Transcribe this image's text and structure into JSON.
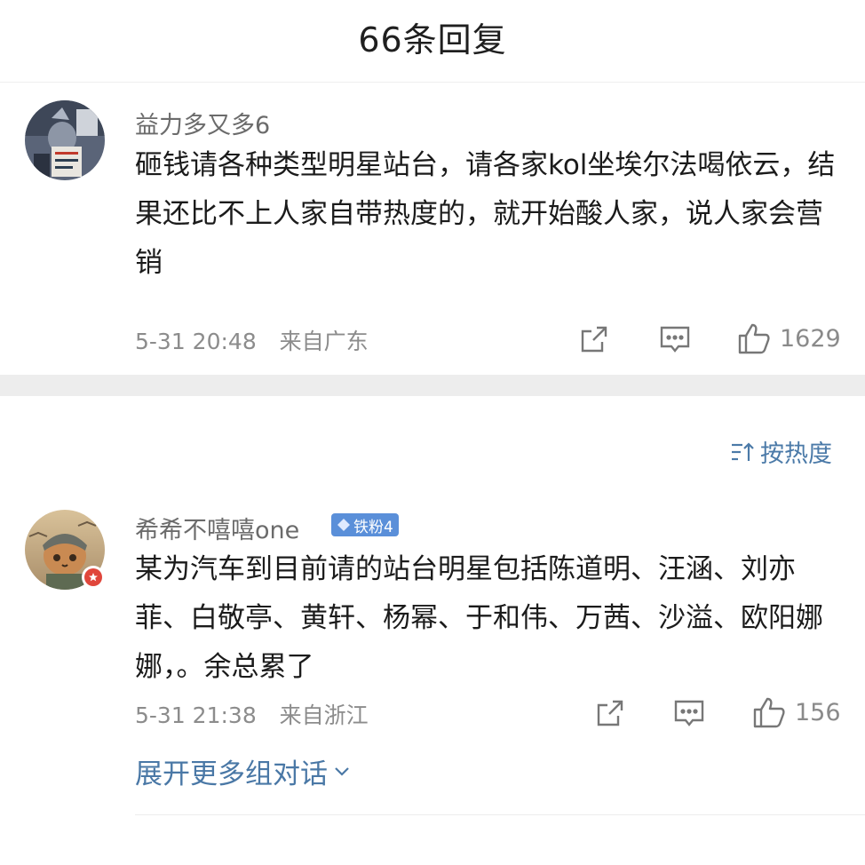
{
  "header": {
    "title": "66条回复"
  },
  "root_comment": {
    "author": "益力多又多6",
    "text": "砸钱请各种类型明星站台，请各家kol坐埃尔法喝依云，结果还比不上人家自带热度的，就开始酸人家，说人家会营销",
    "time": "5-31 20:48",
    "location": "来自广东",
    "likes": "1629",
    "icons": {
      "share": "share-icon",
      "comment": "comment-icon",
      "like": "thumbs-up-icon"
    }
  },
  "sort": {
    "label": "按热度",
    "icon": "sort-icon"
  },
  "reply": {
    "author": "希希不嘻嘻one",
    "badge": "铁粉4",
    "text": "某为汽车到目前请的站台明星包括陈道明、汪涵、刘亦菲、白敬亭、黄轩、杨幂、于和伟、万茜、沙溢、欧阳娜娜，。余总累了",
    "time": "5-31 21:38",
    "location": "来自浙江",
    "likes": "156"
  },
  "expand": {
    "label": "展开更多组对话"
  },
  "colors": {
    "link_blue": "#4a78a6",
    "badge_blue": "#5a8fd9",
    "separator": "#ededed",
    "muted_text": "#8c8c8c"
  }
}
